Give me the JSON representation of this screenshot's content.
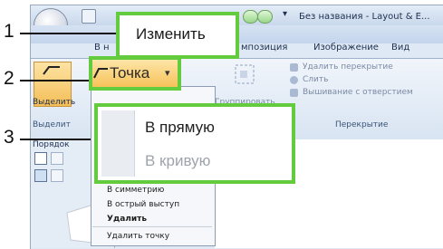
{
  "callouts": [
    "1",
    "2",
    "3"
  ],
  "title": "Без названия - Layout & E...",
  "tabs": {
    "home_partial": "В н",
    "edit": "Изменить",
    "composition_partial": "мпозиция",
    "image": "Изображение",
    "view": "Вид"
  },
  "ribbon": {
    "select_partial": "Выделить",
    "select_group_partial": "Выделит",
    "point_button": "Точка",
    "group_button_partial": "Группировать",
    "remove_overlap": "Удалить перекрытие",
    "merge": "Слить",
    "embroidery_with_hole": "Вышивание с отверстием",
    "overlap_group": "Перекрытие"
  },
  "left_panel": {
    "order_partial": "Порядок"
  },
  "point_submenu": {
    "straight": "В прямую",
    "curve": "В кривую"
  },
  "point_menu": {
    "symmetric_partial": "В симметрию",
    "sharp_peak": "В острый выступ",
    "delete_header": "Удалить",
    "delete_point": "Удалить точку"
  },
  "colors": {
    "highlight": "#63cc3e",
    "point_button": "#f7c35a"
  }
}
